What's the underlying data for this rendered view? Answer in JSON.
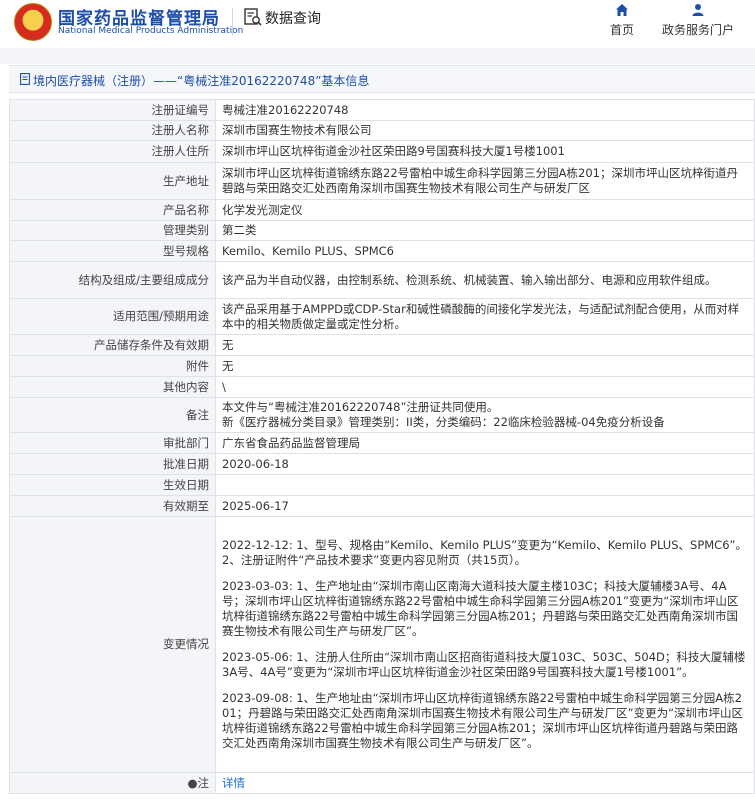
{
  "header": {
    "logo_cn": "国家药品监督管理局",
    "logo_en": "National Medical Products Administration",
    "query_title": "数据查询",
    "nav": [
      {
        "label": "首页",
        "icon": "home-icon"
      },
      {
        "label": "政务服务门户",
        "icon": "user-icon"
      }
    ]
  },
  "breadcrumb": {
    "text": "境内医疗器械（注册）——“粤械注准20162220748”基本信息"
  },
  "fields": [
    {
      "label": "注册证编号",
      "value": "粤械注准20162220748"
    },
    {
      "label": "注册人名称",
      "value": "深圳市国赛生物技术有限公司"
    },
    {
      "label": "注册人住所",
      "value": "深圳市坪山区坑梓街道金沙社区荣田路9号国赛科技大厦1号楼1001"
    },
    {
      "label": "生产地址",
      "value": "深圳市坪山区坑梓街道锦绣东路22号雷柏中城生命科学园第三分园A栋201；深圳市坪山区坑梓街道丹碧路与荣田路交汇处西南角深圳市国赛生物技术有限公司生产与研发厂区"
    },
    {
      "label": "产品名称",
      "value": "化学发光测定仪"
    },
    {
      "label": "管理类别",
      "value": "第二类"
    },
    {
      "label": "型号规格",
      "value": "Kemilo、Kemilo PLUS、SPMC6"
    },
    {
      "label": "结构及组成/主要组成成分",
      "value": "该产品为半自动仪器，由控制系统、检测系统、机械装置、输入输出部分、电源和应用软件组成。"
    },
    {
      "label": "适用范围/预期用途",
      "value": "该产品采用基于AMPPD或CDP-Star和碱性磷酸酶的间接化学发光法，与适配试剂配合使用，从而对样本中的相关物质做定量或定性分析。"
    },
    {
      "label": "产品储存条件及有效期",
      "value": "无"
    },
    {
      "label": "附件",
      "value": "无"
    },
    {
      "label": "其他内容",
      "value": "\\"
    },
    {
      "label": "备注",
      "value": "本文件与“粤械注准20162220748”注册证共同使用。",
      "value2": "新《医疗器械分类目录》管理类别：II类，分类编码：22临床检验器械-04免疫分析设备"
    },
    {
      "label": "审批部门",
      "value": "广东省食品药品监督管理局"
    },
    {
      "label": "批准日期",
      "value": "2020-06-18"
    },
    {
      "label": "生效日期",
      "value": ""
    },
    {
      "label": "有效期至",
      "value": "2025-06-17"
    }
  ],
  "changes": {
    "label": "变更情况",
    "entries": [
      {
        "lines": [
          "2022-12-12: 1、型号、规格由“Kemilo、Kemilo PLUS”变更为“Kemilo、Kemilo PLUS、SPMC6”。",
          "2、注册证附件“产品技术要求”变更内容见附页（共15页）。"
        ]
      },
      {
        "lines": [
          "2023-03-03: 1、生产地址由“深圳市南山区南海大道科技大厦主楼103C；科技大厦辅楼3A号、4A号；深圳市坪山区坑梓街道锦绣东路22号雷柏中城生命科学园第三分园A栋201”变更为“深圳市坪山区坑梓街道锦绣东路22号雷柏中城生命科学园第三分园A栋201；丹碧路与荣田路交汇处西南角深圳市国赛生物技术有限公司生产与研发厂区”。"
        ]
      },
      {
        "lines": [
          "2023-05-06: 1、注册人住所由“深圳市南山区招商街道科技大厦103C、503C、504D；科技大厦辅楼3A号、4A号”变更为“深圳市坪山区坑梓街道金沙社区荣田路9号国赛科技大厦1号楼1001”。"
        ]
      },
      {
        "lines": [
          "2023-09-08: 1、生产地址由“深圳市坪山区坑梓街道锦绣东路22号雷柏中城生命科学园第三分园A栋201；丹碧路与荣田路交汇处西南角深圳市国赛生物技术有限公司生产与研发厂区”变更为“深圳市坪山区坑梓街道锦绣东路22号雷柏中城生命科学园第三分园A栋201；深圳市坪山区坑梓街道丹碧路与荣田路交汇处西南角深圳市国赛生物技术有限公司生产与研发厂区”。"
        ]
      }
    ]
  },
  "note": {
    "label": "注",
    "icon": "pin-icon",
    "link": "详情"
  }
}
